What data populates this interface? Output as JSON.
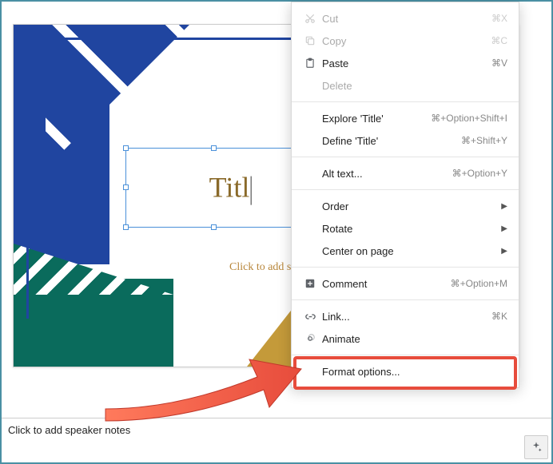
{
  "slide": {
    "title_text": "Titl",
    "subtitle_placeholder": "Click to add s"
  },
  "notes": {
    "placeholder": "Click to add speaker notes"
  },
  "menu": {
    "cut": {
      "label": "Cut",
      "shortcut": "⌘X"
    },
    "copy": {
      "label": "Copy",
      "shortcut": "⌘C"
    },
    "paste": {
      "label": "Paste",
      "shortcut": "⌘V"
    },
    "delete": {
      "label": "Delete"
    },
    "explore": {
      "label": "Explore 'Title'",
      "shortcut": "⌘+Option+Shift+I"
    },
    "define": {
      "label": "Define 'Title'",
      "shortcut": "⌘+Shift+Y"
    },
    "alttext": {
      "label": "Alt text...",
      "shortcut": "⌘+Option+Y"
    },
    "order": {
      "label": "Order"
    },
    "rotate": {
      "label": "Rotate"
    },
    "center": {
      "label": "Center on page"
    },
    "comment": {
      "label": "Comment",
      "shortcut": "⌘+Option+M"
    },
    "link": {
      "label": "Link...",
      "shortcut": "⌘K"
    },
    "animate": {
      "label": "Animate"
    },
    "format": {
      "label": "Format options..."
    }
  }
}
